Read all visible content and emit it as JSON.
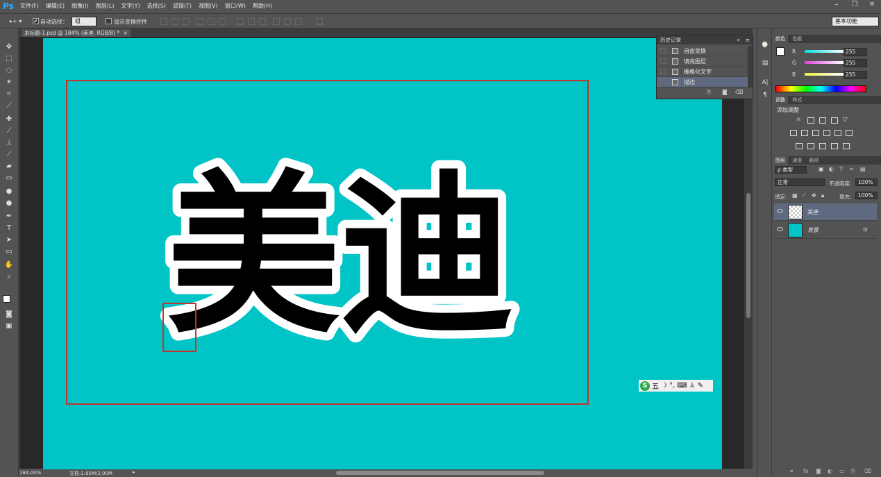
{
  "app": {
    "logo": "Ps"
  },
  "menu": [
    "文件(F)",
    "编辑(E)",
    "图像(I)",
    "图层(L)",
    "文字(Y)",
    "选择(S)",
    "滤镜(T)",
    "视图(V)",
    "窗口(W)",
    "帮助(H)"
  ],
  "window_controls": {
    "minimize": "–",
    "restore": "❐",
    "close": "✕"
  },
  "options": {
    "tool_symbol": "▸+ ▾",
    "auto_select_label": "自动选择：",
    "auto_select_value": "组",
    "show_transform_label": "显示变换控件",
    "workspace": "基本功能"
  },
  "document": {
    "tab_title": "未标题-1.psd @ 184% (美迪, RGB/8) *",
    "tab_close": "×",
    "text": "美迪",
    "canvas_color": "#00c4c5"
  },
  "ime": {
    "logo": "S",
    "mode": "五",
    "icons": [
      "moon-icon",
      "punctuation-icon",
      "keyboard-icon",
      "user-icon",
      "wrench-icon"
    ]
  },
  "status": {
    "zoom": "184.04%",
    "doc_info": "文档:1.85M/2.00M"
  },
  "history": {
    "title": "历史记录",
    "items": [
      {
        "label": "自由变换"
      },
      {
        "label": "填充图层"
      },
      {
        "label": "栅格化文字"
      },
      {
        "label": "描边",
        "selected": true
      }
    ]
  },
  "color_panel": {
    "tabs": [
      "颜色",
      "色板"
    ],
    "channels": [
      {
        "label": "R",
        "value": "255",
        "color": "#00e0e0"
      },
      {
        "label": "G",
        "value": "255",
        "color": "#e040e0"
      },
      {
        "label": "B",
        "value": "255",
        "color": "#f0f040"
      }
    ]
  },
  "adjust_panel": {
    "tabs": [
      "调整",
      "样式"
    ],
    "title": "添加调整"
  },
  "layers_panel": {
    "tabs": [
      "图层",
      "通道",
      "路径"
    ],
    "filter_label": "ρ 类型",
    "blend_mode": "正常",
    "opacity_label": "不透明度:",
    "opacity_value": "100%",
    "lock_label": "锁定:",
    "fill_label": "填充:",
    "fill_value": "100%",
    "layers": [
      {
        "name": "美迪",
        "selected": true,
        "thumb": "transparent"
      },
      {
        "name": "背景",
        "selected": false,
        "thumb": "#00c4c5",
        "locked": true
      }
    ]
  },
  "colors": {
    "selection": "#c0362c",
    "panel_bg": "#535353",
    "dark_bg": "#282828"
  }
}
